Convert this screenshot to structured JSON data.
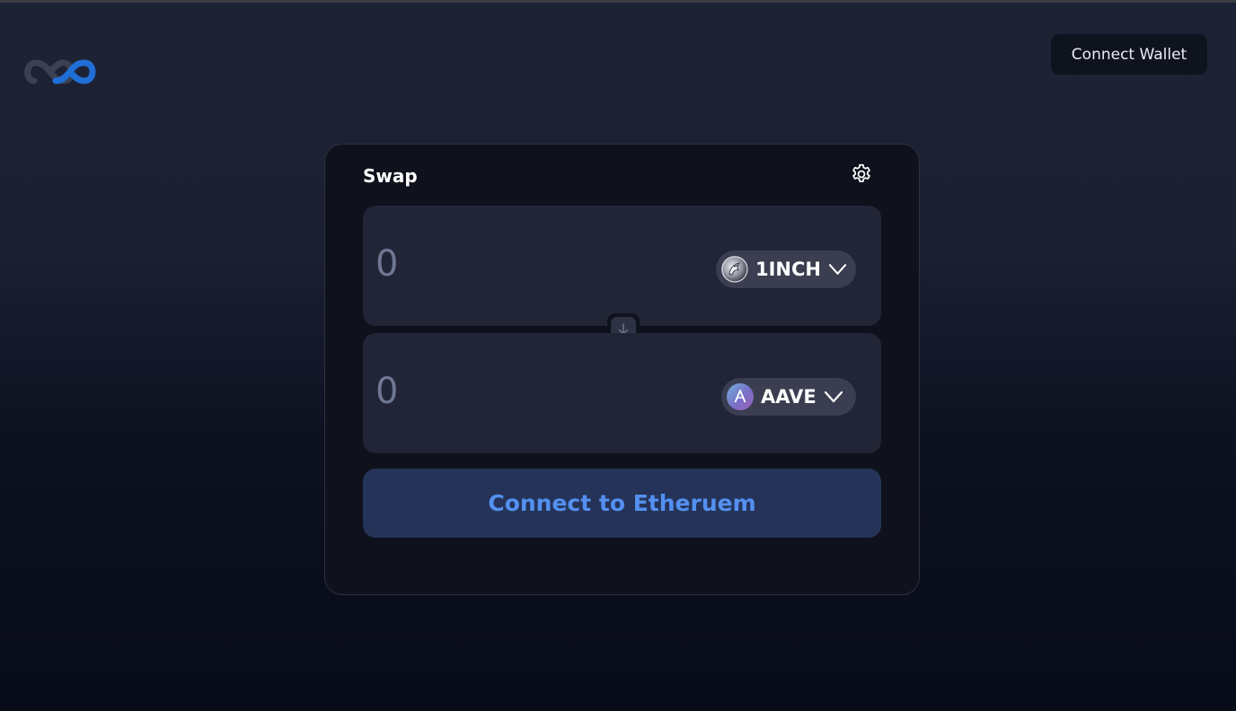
{
  "header": {
    "logo_icon": "infinity-logo-icon",
    "connect_wallet_label": "Connect Wallet"
  },
  "swap": {
    "title": "Swap",
    "settings_icon": "gear-icon",
    "from": {
      "amount_placeholder": "0",
      "token_symbol": "1INCH",
      "token_icon": "1inch-token-icon"
    },
    "switch_icon": "arrow-down-icon",
    "to": {
      "amount_placeholder": "0",
      "token_symbol": "AAVE",
      "token_icon": "aave-token-icon"
    },
    "connect_label": "Connect to Etheruem"
  },
  "colors": {
    "accent": "#5390f0",
    "button_bg": "#253359",
    "card_bg": "#0f121c",
    "panel_bg": "#212536"
  }
}
